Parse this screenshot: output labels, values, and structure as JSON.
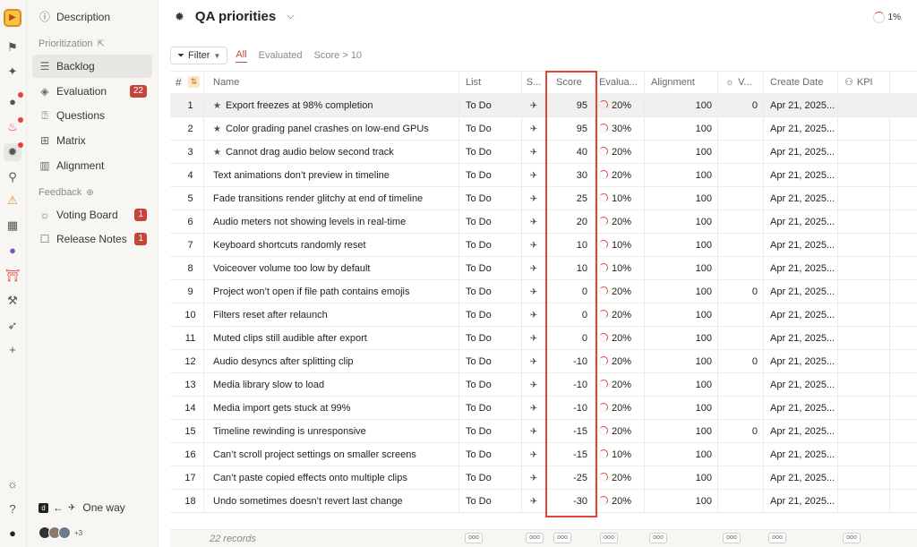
{
  "rail": {
    "icons": [
      "app-logo-icon",
      "flag-icon",
      "gem-icon",
      "planet-icon",
      "fire-icon",
      "bug-icon",
      "pin-icon",
      "warning-bulb-icon",
      "calculator-icon",
      "planet-icon-2",
      "torii-gate-icon",
      "wrench-icon",
      "rocket-icon",
      "plus-icon",
      "lightbulb-icon",
      "help-icon",
      "profile-icon"
    ]
  },
  "sidebar": {
    "description_label": "Description",
    "prioritization_header": "Prioritization",
    "items": [
      {
        "label": "Backlog"
      },
      {
        "label": "Evaluation",
        "badge": "22"
      },
      {
        "label": "Questions"
      },
      {
        "label": "Matrix"
      },
      {
        "label": "Alignment"
      }
    ],
    "feedback_header": "Feedback",
    "feedback_items": [
      {
        "label": "Voting Board",
        "badge": "1"
      },
      {
        "label": "Release Notes",
        "badge": "1"
      }
    ],
    "integration_label": "One way",
    "avatars_more": "+3"
  },
  "header": {
    "title": "QA priorities",
    "progress_percent": "1%"
  },
  "filterbar": {
    "filter_label": "Filter",
    "tabs": [
      "All",
      "Evaluated",
      "Score > 10"
    ],
    "active_tab": "All"
  },
  "table": {
    "columns": {
      "num": "#",
      "name": "Name",
      "list": "List",
      "s": "S...",
      "score": "Score",
      "eval": "Evalua...",
      "alignment": "Alignment",
      "votes": "V...",
      "date": "Create Date",
      "kpi": "KPI"
    },
    "rows": [
      {
        "n": "1",
        "name": "Export freezes at 98% completion",
        "star": true,
        "list": "To Do",
        "score": "95",
        "eval": "20%",
        "align": "100",
        "votes": "0",
        "date": "Apr 21, 2025..."
      },
      {
        "n": "2",
        "name": "Color grading panel crashes on low-end GPUs",
        "star": true,
        "list": "To Do",
        "score": "95",
        "eval": "30%",
        "align": "100",
        "votes": "",
        "date": "Apr 21, 2025..."
      },
      {
        "n": "3",
        "name": "Cannot drag audio below second track",
        "star": true,
        "list": "To Do",
        "score": "40",
        "eval": "20%",
        "align": "100",
        "votes": "",
        "date": "Apr 21, 2025..."
      },
      {
        "n": "4",
        "name": "Text animations don’t preview in timeline",
        "star": false,
        "list": "To Do",
        "score": "30",
        "eval": "20%",
        "align": "100",
        "votes": "",
        "date": "Apr 21, 2025..."
      },
      {
        "n": "5",
        "name": "Fade transitions render glitchy at end of timeline",
        "star": false,
        "list": "To Do",
        "score": "25",
        "eval": "10%",
        "align": "100",
        "votes": "",
        "date": "Apr 21, 2025..."
      },
      {
        "n": "6",
        "name": "Audio meters not showing levels in real-time",
        "star": false,
        "list": "To Do",
        "score": "20",
        "eval": "20%",
        "align": "100",
        "votes": "",
        "date": "Apr 21, 2025..."
      },
      {
        "n": "7",
        "name": "Keyboard shortcuts randomly reset",
        "star": false,
        "list": "To Do",
        "score": "10",
        "eval": "10%",
        "align": "100",
        "votes": "",
        "date": "Apr 21, 2025..."
      },
      {
        "n": "8",
        "name": "Voiceover volume too low by default",
        "star": false,
        "list": "To Do",
        "score": "10",
        "eval": "10%",
        "align": "100",
        "votes": "",
        "date": "Apr 21, 2025..."
      },
      {
        "n": "9",
        "name": "Project won’t open if file path contains emojis",
        "star": false,
        "list": "To Do",
        "score": "0",
        "eval": "20%",
        "align": "100",
        "votes": "0",
        "date": "Apr 21, 2025..."
      },
      {
        "n": "10",
        "name": "Filters reset after relaunch",
        "star": false,
        "list": "To Do",
        "score": "0",
        "eval": "20%",
        "align": "100",
        "votes": "",
        "date": "Apr 21, 2025..."
      },
      {
        "n": "11",
        "name": "Muted clips still audible after export",
        "star": false,
        "list": "To Do",
        "score": "0",
        "eval": "20%",
        "align": "100",
        "votes": "",
        "date": "Apr 21, 2025..."
      },
      {
        "n": "12",
        "name": "Audio desyncs after splitting clip",
        "star": false,
        "list": "To Do",
        "score": "-10",
        "eval": "20%",
        "align": "100",
        "votes": "0",
        "date": "Apr 21, 2025..."
      },
      {
        "n": "13",
        "name": "Media library slow to load",
        "star": false,
        "list": "To Do",
        "score": "-10",
        "eval": "20%",
        "align": "100",
        "votes": "",
        "date": "Apr 21, 2025..."
      },
      {
        "n": "14",
        "name": "Media import gets stuck at 99%",
        "star": false,
        "list": "To Do",
        "score": "-10",
        "eval": "20%",
        "align": "100",
        "votes": "",
        "date": "Apr 21, 2025..."
      },
      {
        "n": "15",
        "name": "Timeline rewinding is unresponsive",
        "star": false,
        "list": "To Do",
        "score": "-15",
        "eval": "20%",
        "align": "100",
        "votes": "0",
        "date": "Apr 21, 2025..."
      },
      {
        "n": "16",
        "name": "Can’t scroll project settings on smaller screens",
        "star": false,
        "list": "To Do",
        "score": "-15",
        "eval": "10%",
        "align": "100",
        "votes": "",
        "date": "Apr 21, 2025..."
      },
      {
        "n": "17",
        "name": "Can’t paste copied effects onto multiple clips",
        "star": false,
        "list": "To Do",
        "score": "-25",
        "eval": "20%",
        "align": "100",
        "votes": "",
        "date": "Apr 21, 2025..."
      },
      {
        "n": "18",
        "name": "Undo sometimes doesn’t revert last change",
        "star": false,
        "list": "To Do",
        "score": "-30",
        "eval": "20%",
        "align": "100",
        "votes": "",
        "date": "Apr 21, 2025..."
      }
    ],
    "footer_records": "22 records",
    "footer_agg": "ooo"
  },
  "colors": {
    "accent": "#c4453a",
    "highlight": "#e0443a",
    "sidebar_bg": "#f7f6f3"
  }
}
